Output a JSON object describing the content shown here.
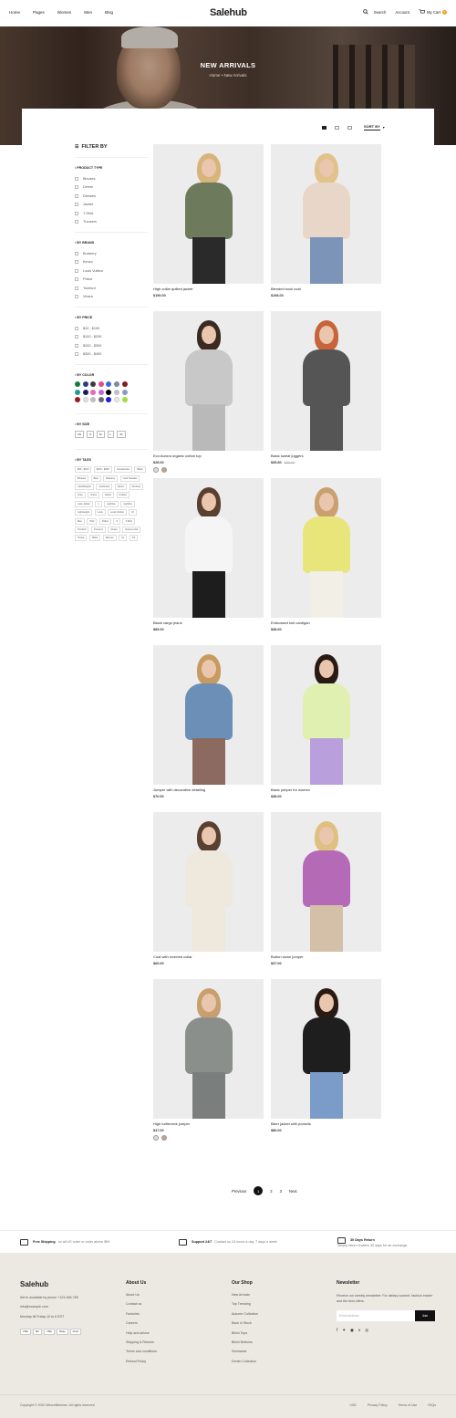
{
  "header": {
    "nav": [
      "Home",
      "Pages",
      "Women",
      "Men",
      "Blog"
    ],
    "logo": "Salehub",
    "search_label": "Search",
    "account_label": "Account",
    "cart_label": "My Cart",
    "cart_count": "0"
  },
  "hero": {
    "title": "NEW ARRIVALS",
    "breadcrumb": "Home • New Arrivals"
  },
  "toolbar": {
    "sort_label": "SORT BY"
  },
  "sidebar": {
    "title": "FILTER BY",
    "product_type": {
      "label": "PRODUCT TYPE",
      "items": [
        "Blouses",
        "Denim",
        "Dresses",
        "Jacket",
        "T-Shirt",
        "Trousers"
      ]
    },
    "brand": {
      "label": "BY BRAND",
      "items": [
        "Burberry",
        "Kenzo",
        "Louis Vuitton",
        "Police",
        "Tomford",
        "Vivara"
      ]
    },
    "price": {
      "label": "BY PRICE",
      "items": [
        "$10 - $100",
        "$100 - $200",
        "$200 - $300",
        "$300 - $400"
      ]
    },
    "color": {
      "label": "BY COLOR",
      "swatches": [
        "#1a7a3a",
        "#2d3a8c",
        "#3c3c3c",
        "#e54a8a",
        "#3a6fd1",
        "#7a8aa0",
        "#8b1a1a",
        "#2a9a8a",
        "#1a1a6a",
        "#e56ab0",
        "#b86ae0",
        "#000000",
        "#c0c0c0",
        "#8a9ac0",
        "#9a1a1a",
        "#e0e0e0",
        "#bcbcbc",
        "#6a6a6a",
        "#1a1ae0",
        "#e8e8e8",
        "#9ae03a"
      ]
    },
    "size": {
      "label": "BY SIZE",
      "items": [
        "XS",
        "S",
        "M",
        "L",
        "XL"
      ]
    },
    "tags": {
      "label": "BY TAGS",
      "items": [
        "$50 - $100",
        "$100 - $200",
        "Accessories",
        "Black",
        "Blouses",
        "Blue",
        "Burberry",
        "Card Sweater",
        "Cardshopper",
        "Cashmere",
        "Denim",
        "Dresses",
        "Gray",
        "Green",
        "Jacket",
        "Knitted",
        "Lace Jacket",
        "L",
        "Lightline",
        "Lightline",
        "Lightweight",
        "Louis",
        "Louis Vuitton",
        "M",
        "Men",
        "Pink",
        "Police",
        "S",
        "T-Shirt",
        "Tomford",
        "Trousers",
        "Vivara",
        "Vivara Local",
        "Vivara",
        "White",
        "Women",
        "XL",
        "XS"
      ]
    }
  },
  "products": [
    {
      "name": "High collar quilted jacket",
      "price": "$150.00",
      "sale": ""
    },
    {
      "name": "Blended wool coat",
      "price": "$198.00",
      "sale": ""
    },
    {
      "name": "Eco Aurora organic cotton top",
      "price": "$28.00",
      "sale": ""
    },
    {
      "name": "Basic sweat joggers",
      "price": "$35.80",
      "sale": "$50.00"
    },
    {
      "name": "Black cargo jeans",
      "price": "$89.00",
      "sale": ""
    },
    {
      "name": "Embossed knit cardigan",
      "price": "$38.00",
      "sale": ""
    },
    {
      "name": "Jumper with decorative detailing",
      "price": "$70.00",
      "sale": ""
    },
    {
      "name": "Basic jumper for women",
      "price": "$38.00",
      "sale": ""
    },
    {
      "name": "Coat with inverted collar",
      "price": "$66.00",
      "sale": ""
    },
    {
      "name": "Button down jumper",
      "price": "$37.00",
      "sale": ""
    },
    {
      "name": "High turtleneck jumper",
      "price": "$47.00",
      "sale": ""
    },
    {
      "name": "Biker jacket with pockets",
      "price": "$86.00",
      "sale": ""
    }
  ],
  "pagination": {
    "prev": "Previous",
    "pages": [
      "1",
      "2",
      "3"
    ],
    "next": "Next"
  },
  "services": [
    {
      "title": "Free Shipping",
      "text": "on all US order or order above $99"
    },
    {
      "title": "Support 24/7",
      "text": "Contact us 24 hours a day, 7 days a week"
    },
    {
      "title": "30 Days Return",
      "text": "Simply return it within 30 days for an exchange"
    }
  ],
  "footer": {
    "logo": "Salehub",
    "contact": [
      "We're available by phone +123-456-789",
      "info@example.com",
      "Monday till Friday 10 to 6 EST"
    ],
    "payments": [
      "VISA",
      "MC",
      "VISA",
      "Stripe",
      "Amex"
    ],
    "about": {
      "title": "About Us",
      "links": [
        "About Us",
        "Contact us",
        "Factories",
        "Careers",
        "Help and advice",
        "Shipping & Returns",
        "Terms and conditions",
        "Refund Policy"
      ]
    },
    "shop": {
      "title": "Our Shop",
      "links": [
        "New Arrivals",
        "Top Trending",
        "Autumn Collection",
        "Back in Stock",
        "Bikini Tops",
        "Bikini Bottoms",
        "Swimwear",
        "Denim Collection"
      ]
    },
    "newsletter": {
      "title": "Newsletter",
      "text": "Receive our weekly newsletter. For dietary content, fashion insider and the best offers.",
      "placeholder": "Email address",
      "button": "Join"
    },
    "copyright": "Copyright © 2020 Wexcellthemes. All rights reserved",
    "currency": "USD",
    "bottom_links": [
      "Privacy Policy",
      "Terms of Use",
      "FAQs"
    ]
  }
}
